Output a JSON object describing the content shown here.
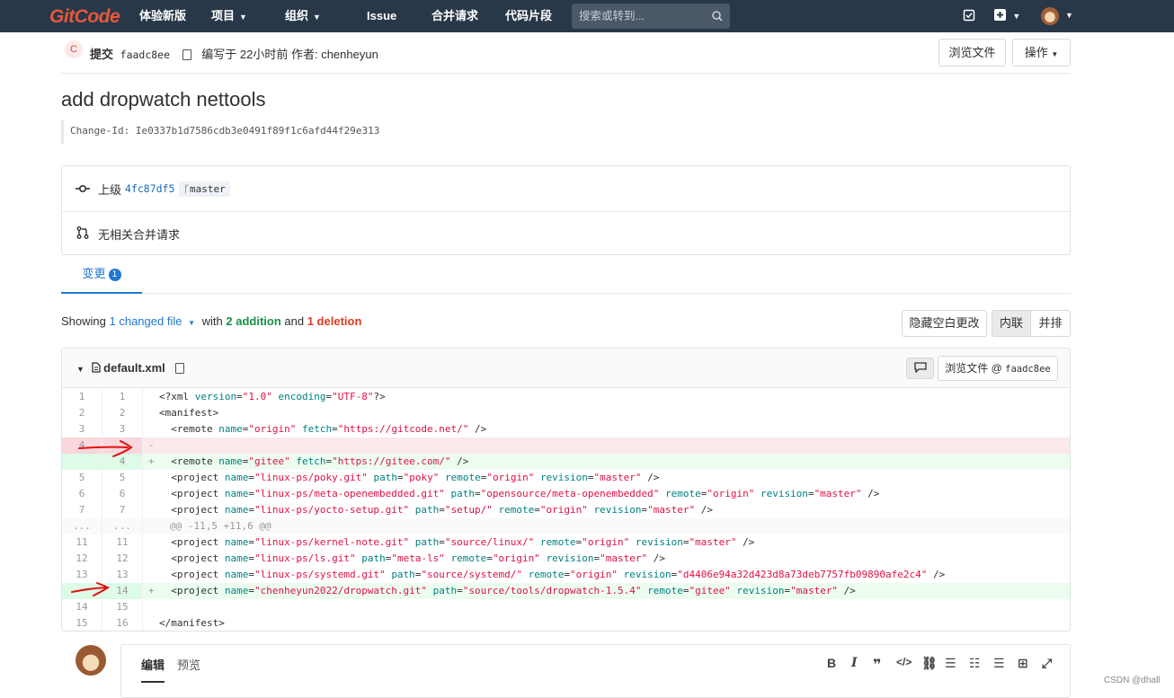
{
  "navbar": {
    "logo": "GitCode",
    "items": [
      "体验新版",
      "项目",
      "组织",
      "Issue",
      "合并请求",
      "代码片段"
    ],
    "search_placeholder": "搜索或转到..."
  },
  "commit": {
    "author_initial": "C",
    "label": "提交",
    "sha": "faadc8ee",
    "meta": "编写于 22小时前 作者: chenheyun",
    "browse_button": "浏览文件",
    "actions_button": "操作",
    "title": "add dropwatch nettools",
    "change_id": "Change-Id: Ie0337b1d7586cdb3e0491f89f1c6afd44f29e313",
    "parent_label": "上级",
    "parent_sha": "4fc87df5",
    "branch": "master",
    "mr_text": "无相关合并请求"
  },
  "tabs": {
    "changes_label": "变更",
    "changes_count": "1"
  },
  "summary": {
    "showing": "Showing",
    "changed": "1 changed file",
    "with": "with",
    "additions": "2 addition",
    "and": "and",
    "deletions": "1 deletion",
    "hide_whitespace": "隐藏空白更改",
    "inline": "内联",
    "side_by_side": "并排"
  },
  "file": {
    "name": "default.xml",
    "view_button": "浏览文件 @",
    "view_sha": "faadc8ee"
  },
  "diff_lines": [
    {
      "type": "ctx",
      "old": "1",
      "new": "1",
      "sign": " ",
      "code": "<?xml version=\"1.0\" encoding=\"UTF-8\"?>"
    },
    {
      "type": "ctx",
      "old": "2",
      "new": "2",
      "sign": " ",
      "code": "<manifest>"
    },
    {
      "type": "ctx",
      "old": "3",
      "new": "3",
      "sign": " ",
      "code": "  <remote name=\"origin\" fetch=\"https://gitcode.net/\" />"
    },
    {
      "type": "del",
      "old": "4",
      "new": "",
      "sign": "-",
      "code": ""
    },
    {
      "type": "add",
      "old": "",
      "new": "4",
      "sign": "+",
      "code": "  <remote name=\"gitee\" fetch=\"https://gitee.com/\" />"
    },
    {
      "type": "ctx",
      "old": "5",
      "new": "5",
      "sign": " ",
      "code": "  <project name=\"linux-ps/poky.git\" path=\"poky\" remote=\"origin\" revision=\"master\" />"
    },
    {
      "type": "ctx",
      "old": "6",
      "new": "6",
      "sign": " ",
      "code": "  <project name=\"linux-ps/meta-openembedded.git\" path=\"opensource/meta-openembedded\" remote=\"origin\" revision=\"master\" />"
    },
    {
      "type": "ctx",
      "old": "7",
      "new": "7",
      "sign": " ",
      "code": "  <project name=\"linux-ps/yocto-setup.git\" path=\"setup/\" remote=\"origin\" revision=\"master\" />"
    },
    {
      "type": "hunk",
      "old": "...",
      "new": "...",
      "sign": "",
      "code": "@@ -11,5 +11,6 @@"
    },
    {
      "type": "ctx",
      "old": "11",
      "new": "11",
      "sign": " ",
      "code": "  <project name=\"linux-ps/kernel-note.git\" path=\"source/linux/\" remote=\"origin\" revision=\"master\" />"
    },
    {
      "type": "ctx",
      "old": "12",
      "new": "12",
      "sign": " ",
      "code": "  <project name=\"linux-ps/ls.git\" path=\"meta-ls\" remote=\"origin\" revision=\"master\" />"
    },
    {
      "type": "ctx",
      "old": "13",
      "new": "13",
      "sign": " ",
      "code": "  <project name=\"linux-ps/systemd.git\" path=\"source/systemd/\" remote=\"origin\" revision=\"d4406e94a32d423d8a73deb7757fb09890afe2c4\" />"
    },
    {
      "type": "add",
      "old": "",
      "new": "14",
      "sign": "+",
      "code": "  <project name=\"chenheyun2022/dropwatch.git\" path=\"source/tools/dropwatch-1.5.4\" remote=\"gitee\" revision=\"master\" />"
    },
    {
      "type": "ctx",
      "old": "14",
      "new": "15",
      "sign": " ",
      "code": ""
    },
    {
      "type": "ctx",
      "old": "15",
      "new": "16",
      "sign": " ",
      "code": "</manifest>"
    }
  ],
  "editor": {
    "tab_edit": "编辑",
    "tab_preview": "预览"
  },
  "watermark": "CSDN @dhall"
}
